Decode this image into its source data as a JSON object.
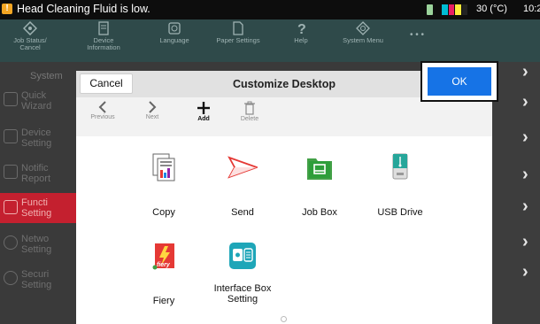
{
  "status": {
    "warning_icon": "warning-icon",
    "message": "Head Cleaning Fluid is low.",
    "temperature": "30 (°C)",
    "time": "10:2",
    "ink_colors": [
      "#00bcd4",
      "#e91e63",
      "#ffeb3b",
      "#222222"
    ]
  },
  "toolbar": {
    "items": [
      {
        "label": "Job Status/\nCancel",
        "icon": "job-status-icon"
      },
      {
        "label": "Device\nInformation",
        "icon": "device-info-icon"
      },
      {
        "label": "Language",
        "icon": "language-icon"
      },
      {
        "label": "Paper Settings",
        "icon": "paper-settings-icon"
      },
      {
        "label": "Help",
        "icon": "help-icon"
      },
      {
        "label": "System Menu",
        "icon": "system-menu-icon"
      },
      {
        "label": "• • •",
        "icon": "more-icon"
      }
    ]
  },
  "background": {
    "header": "System",
    "rows": [
      "Quick\nWizard",
      "Device\nSetting",
      "Notific\nReport",
      "Functi\nSetting",
      "Netwo\nSetting",
      "Securi\nSetting"
    ]
  },
  "dialog": {
    "title": "Customize Desktop",
    "cancel_label": "Cancel",
    "ok_label": "OK",
    "tools": {
      "previous": "Previous",
      "next": "Next",
      "add": "Add",
      "delete": "Delete"
    },
    "apps": [
      {
        "label": "Copy",
        "icon": "copy-icon"
      },
      {
        "label": "Send",
        "icon": "send-icon"
      },
      {
        "label": "Job Box",
        "icon": "job-box-icon"
      },
      {
        "label": "USB Drive",
        "icon": "usb-drive-icon"
      },
      {
        "label": "Fiery",
        "icon": "fiery-icon"
      },
      {
        "label": "Interface Box\nSetting",
        "icon": "interface-box-icon"
      }
    ]
  },
  "colors": {
    "accent": "#1673e6",
    "toolbar": "#2f4a4a",
    "warning": "#f5a623",
    "function_highlight": "#c4202f"
  }
}
